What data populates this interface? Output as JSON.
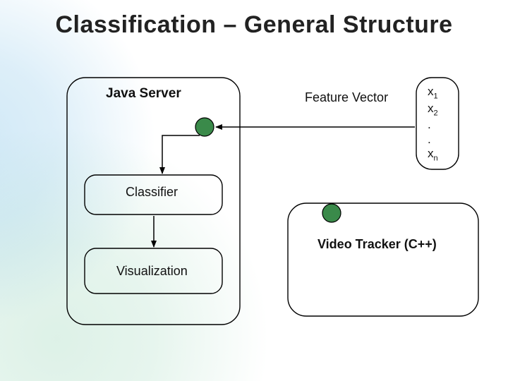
{
  "title": "Classification – General Structure",
  "boxes": {
    "java_server": "Java Server",
    "classifier": "Classifier",
    "visualization": "Visualization",
    "video_tracker": "Video Tracker (C++)"
  },
  "feature_vector": {
    "label": "Feature Vector",
    "items": [
      "x1",
      "x2",
      ".",
      ".",
      "xn"
    ]
  },
  "colors": {
    "node_fill": "#3a8a4a",
    "node_stroke": "#000000",
    "box_stroke": "#000000",
    "arrow": "#000000"
  }
}
